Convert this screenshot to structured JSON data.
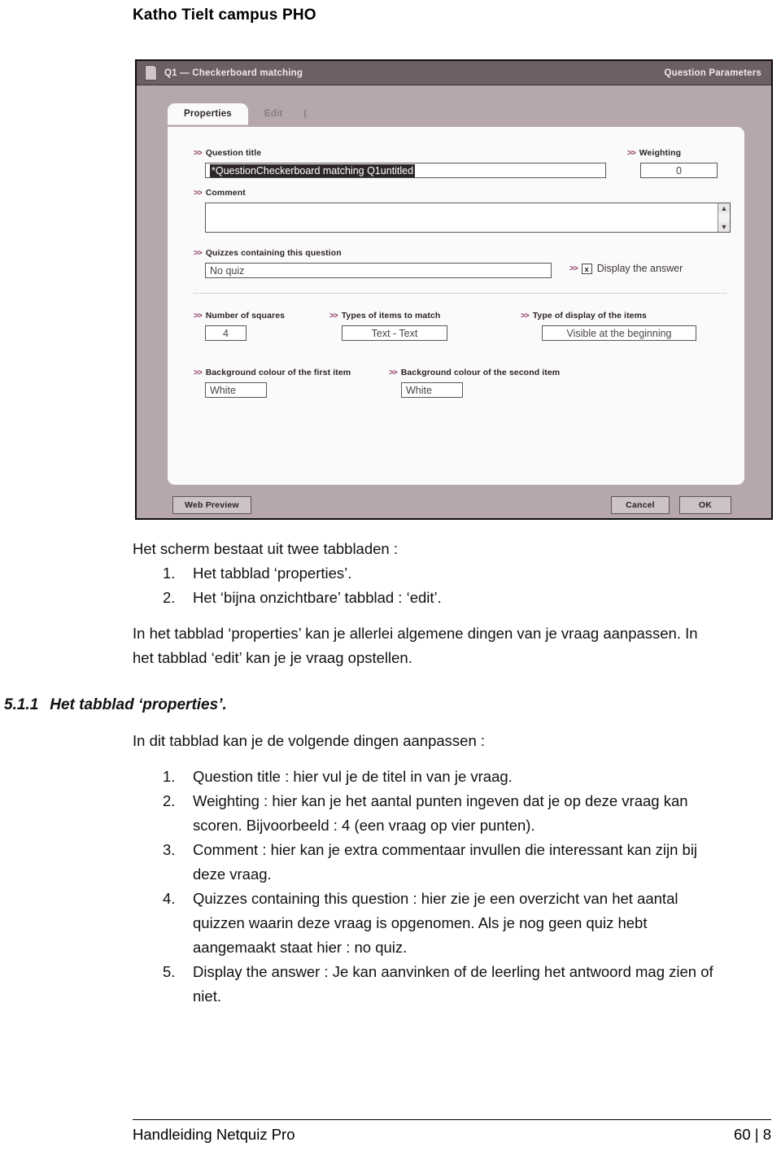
{
  "page_header": "Katho Tielt campus PHO",
  "dialog": {
    "titlebar": {
      "left": "Q1 — Checkerboard matching",
      "right": "Question Parameters",
      "icon": "document-icon"
    },
    "tabs": [
      {
        "label": "Properties",
        "active": true
      },
      {
        "label": "Edit",
        "active": false
      },
      {
        "label": "(",
        "active": false
      }
    ],
    "fields": {
      "question_title_label": "Question title",
      "question_title_value": "*QuestionCheckerboard matching Q1untitled",
      "weighting_label": "Weighting",
      "weighting_value": "0",
      "comment_label": "Comment",
      "comment_value": "",
      "quizzes_label": "Quizzes containing this question",
      "quizzes_value": "No quiz",
      "display_answer_label": "Display the answer",
      "display_answer_checked": "x",
      "number_of_squares_label": "Number of squares",
      "number_of_squares_value": "4",
      "types_items_label": "Types of items to match",
      "types_items_value": "Text - Text",
      "type_display_label": "Type of display of the items",
      "type_display_value": "Visible at the beginning",
      "bg_first_label": "Background colour of the first item",
      "bg_first_value": "White",
      "bg_second_label": "Background colour of the second item",
      "bg_second_value": "White"
    },
    "buttons": {
      "web_preview": "Web Preview",
      "cancel": "Cancel",
      "ok": "OK"
    },
    "colors": {
      "titlebar": "#6e5f63",
      "dialog_bg": "#b5a7ab",
      "panel": "#fbfafa",
      "bullet": "#8c3b66"
    }
  },
  "body": {
    "intro_line": "Het scherm bestaat uit twee tabbladen :",
    "intro_list": [
      {
        "num": "1.",
        "text": "Het tabblad ‘properties’."
      },
      {
        "num": "2.",
        "text": "Het ‘bijna onzichtbare’ tabblad : ‘edit’."
      }
    ],
    "paragraph_1_line_1": "In het tabblad ‘properties’ kan je allerlei algemene dingen van je vraag aanpassen.  In",
    "paragraph_1_line_2": "het tabblad ‘edit’ kan je je vraag opstellen.",
    "heading_number": "5.1.1",
    "heading_text": "Het tabblad ‘properties’.",
    "intro_line_2": "In dit tabblad kan je de volgende dingen aanpassen :",
    "main_list": [
      {
        "num": "1.",
        "lines": [
          "Question title : hier vul je de titel in van je vraag."
        ]
      },
      {
        "num": "2.",
        "lines": [
          "Weighting : hier kan je het aantal punten ingeven dat je op deze vraag kan",
          "scoren.  Bijvoorbeeld : 4 (een vraag op vier punten)."
        ]
      },
      {
        "num": "3.",
        "lines": [
          "Comment : hier kan je extra commentaar invullen die interessant kan zijn bij",
          "deze vraag."
        ]
      },
      {
        "num": "4.",
        "lines": [
          "Quizzes containing this question : hier zie je een overzicht van het aantal",
          "quizzen waarin deze vraag is opgenomen.  Als je nog geen quiz hebt",
          "aangemaakt staat hier : no quiz."
        ]
      },
      {
        "num": "5.",
        "lines": [
          "Display the answer : Je kan aanvinken of de leerling het antwoord mag zien of",
          "niet."
        ]
      }
    ]
  },
  "footer": {
    "left": "Handleiding Netquiz Pro",
    "right": "60 | 8"
  }
}
